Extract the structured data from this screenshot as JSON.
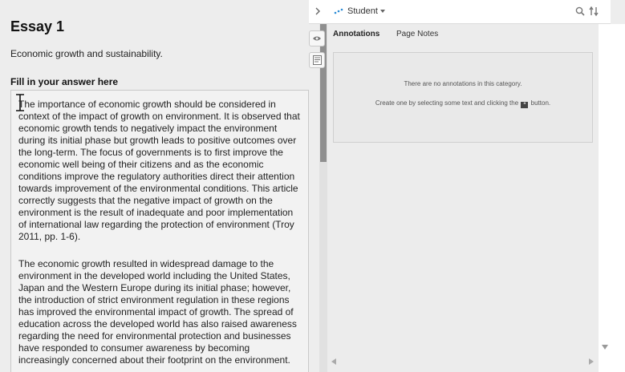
{
  "essay": {
    "title": "Essay 1",
    "prompt": "Economic growth and sustainability.",
    "answer_label": "Fill in your answer here",
    "paragraphs": [
      "The importance of economic growth should be considered in context of the impact of growth on environment. It is observed that economic growth tends to negatively impact the environment during its initial phase but growth leads to positive outcomes over the long-term. The focus of governments is to first improve the economic well being of their citizens and as the economic conditions improve the regulatory authorities direct their attention towards improvement of the environmental conditions. This article correctly suggests that the negative impact of growth on the environment is the result of inadequate and poor implementation of international law regarding the protection of environment (Troy 2011, pp. 1-6).",
      "The economic growth resulted in widespread damage to the environment in the developed world including the United States, Japan and the Western Europe during its initial phase; however, the introduction of strict environment regulation in these regions has improved the environmental impact of growth. The spread of education across the developed world has also raised awareness regarding the need for environmental protection and businesses have responded to consumer awareness by becoming increasingly concerned about their footprint on the environment."
    ]
  },
  "annotations": {
    "user_label": "Student",
    "tabs": [
      "Annotations",
      "Page Notes"
    ],
    "empty_message": "There are no annotations in this category.",
    "create_prefix": "Create one by selecting some text and clicking the",
    "create_suffix": "button."
  },
  "icons": [
    "chevron-right-icon",
    "dots-icon",
    "caret-down-icon",
    "search-icon",
    "sync-icon",
    "eye-icon",
    "notes-icon",
    "highlight-icon"
  ],
  "colors": {
    "accent": "#2a8bd6",
    "panel": "#ececec",
    "scroll_thumb": "#8f8f8f"
  }
}
